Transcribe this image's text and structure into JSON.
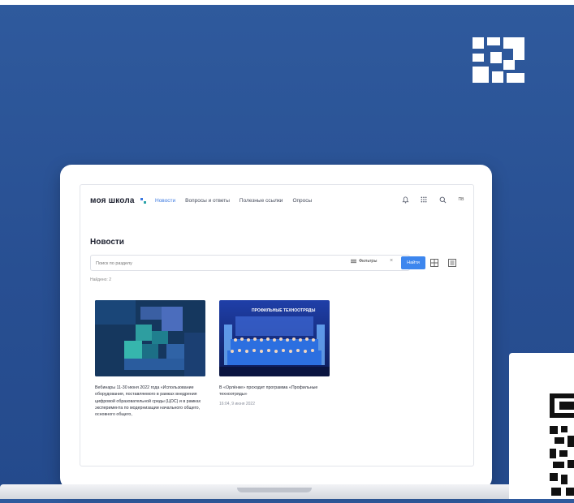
{
  "header": {
    "logo_text": "моя школа",
    "nav": [
      "Новости",
      "Вопросы и ответы",
      "Полезные ссылки",
      "Опросы"
    ],
    "active_nav": "Новости",
    "avatar_text": "ПВ"
  },
  "page": {
    "title": "Новости",
    "search_placeholder": "Поиск по разделу",
    "filters_label": "Фильтры",
    "find_button": "Найти",
    "found_text": "Найдено: 2"
  },
  "cards": [
    {
      "text": "Вебинары 11-30 июня 2022 года «Использование оборудования, поставляемого в рамках внедрения цифровой образовательной среды (ЦОС) и в рамках эксперимента по модернизации начального общего, основного общего,",
      "meta": ""
    },
    {
      "text": "В «Орлёнке» проходит программа «Профильные техноотряды»",
      "meta": "16:04, 9 июня 2022",
      "image_caption": "ПРОФИЛЬНЫЕ ТЕХНООТРЯДЫ"
    }
  ],
  "colors": {
    "background": "#2b5497",
    "accent": "#3d86ee",
    "card_dark": "#15375e",
    "card_teal": "#2aa3a8"
  },
  "icons": [
    "bell-icon",
    "apps-icon",
    "search-icon",
    "filter-icon",
    "close-icon",
    "grid-view-icon",
    "list-view-icon",
    "qr-code-icon"
  ]
}
